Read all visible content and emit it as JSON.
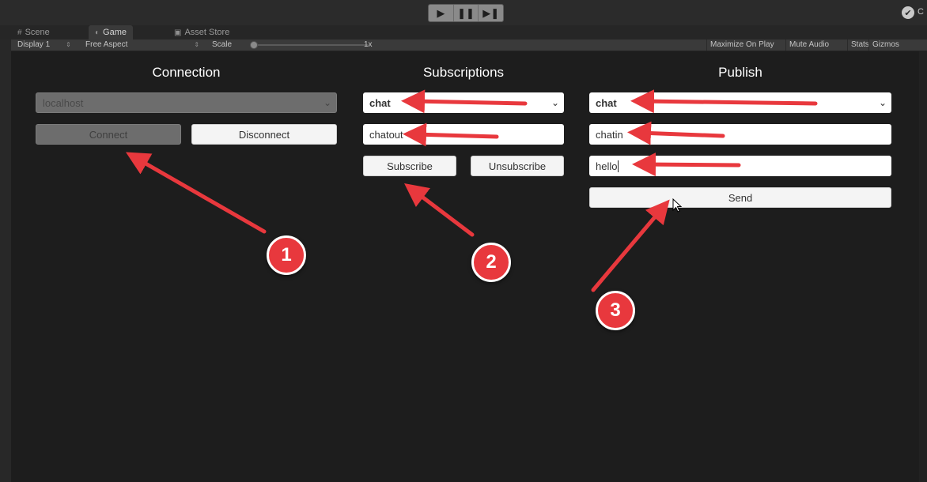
{
  "toolbar": {
    "play_controls": [
      "▶",
      "❚❚",
      "▶❚"
    ]
  },
  "tabs": [
    {
      "icon": "#",
      "label": "Scene"
    },
    {
      "icon": "◐",
      "label": "Game"
    },
    {
      "icon": "▣",
      "label": "Asset Store"
    }
  ],
  "game_toolbar": {
    "display": "Display 1",
    "aspect": "Free Aspect",
    "scale_label": "Scale",
    "scale_value": "1x",
    "maximize": "Maximize On Play",
    "mute": "Mute Audio",
    "stats": "Stats",
    "gizmos": "Gizmos"
  },
  "connection": {
    "title": "Connection",
    "host": "localhost",
    "connect": "Connect",
    "disconnect": "Disconnect"
  },
  "subscriptions": {
    "title": "Subscriptions",
    "selected_topic": "chat",
    "topic_input": "chatout",
    "subscribe": "Subscribe",
    "unsubscribe": "Unsubscribe"
  },
  "publish": {
    "title": "Publish",
    "selected_topic": "chat",
    "topic_input": "chatin",
    "message_input": "hello",
    "send": "Send"
  },
  "annotations": [
    "1",
    "2",
    "3"
  ],
  "colors": {
    "annotation_red": "#e8383d",
    "background": "#1d1d1d"
  }
}
